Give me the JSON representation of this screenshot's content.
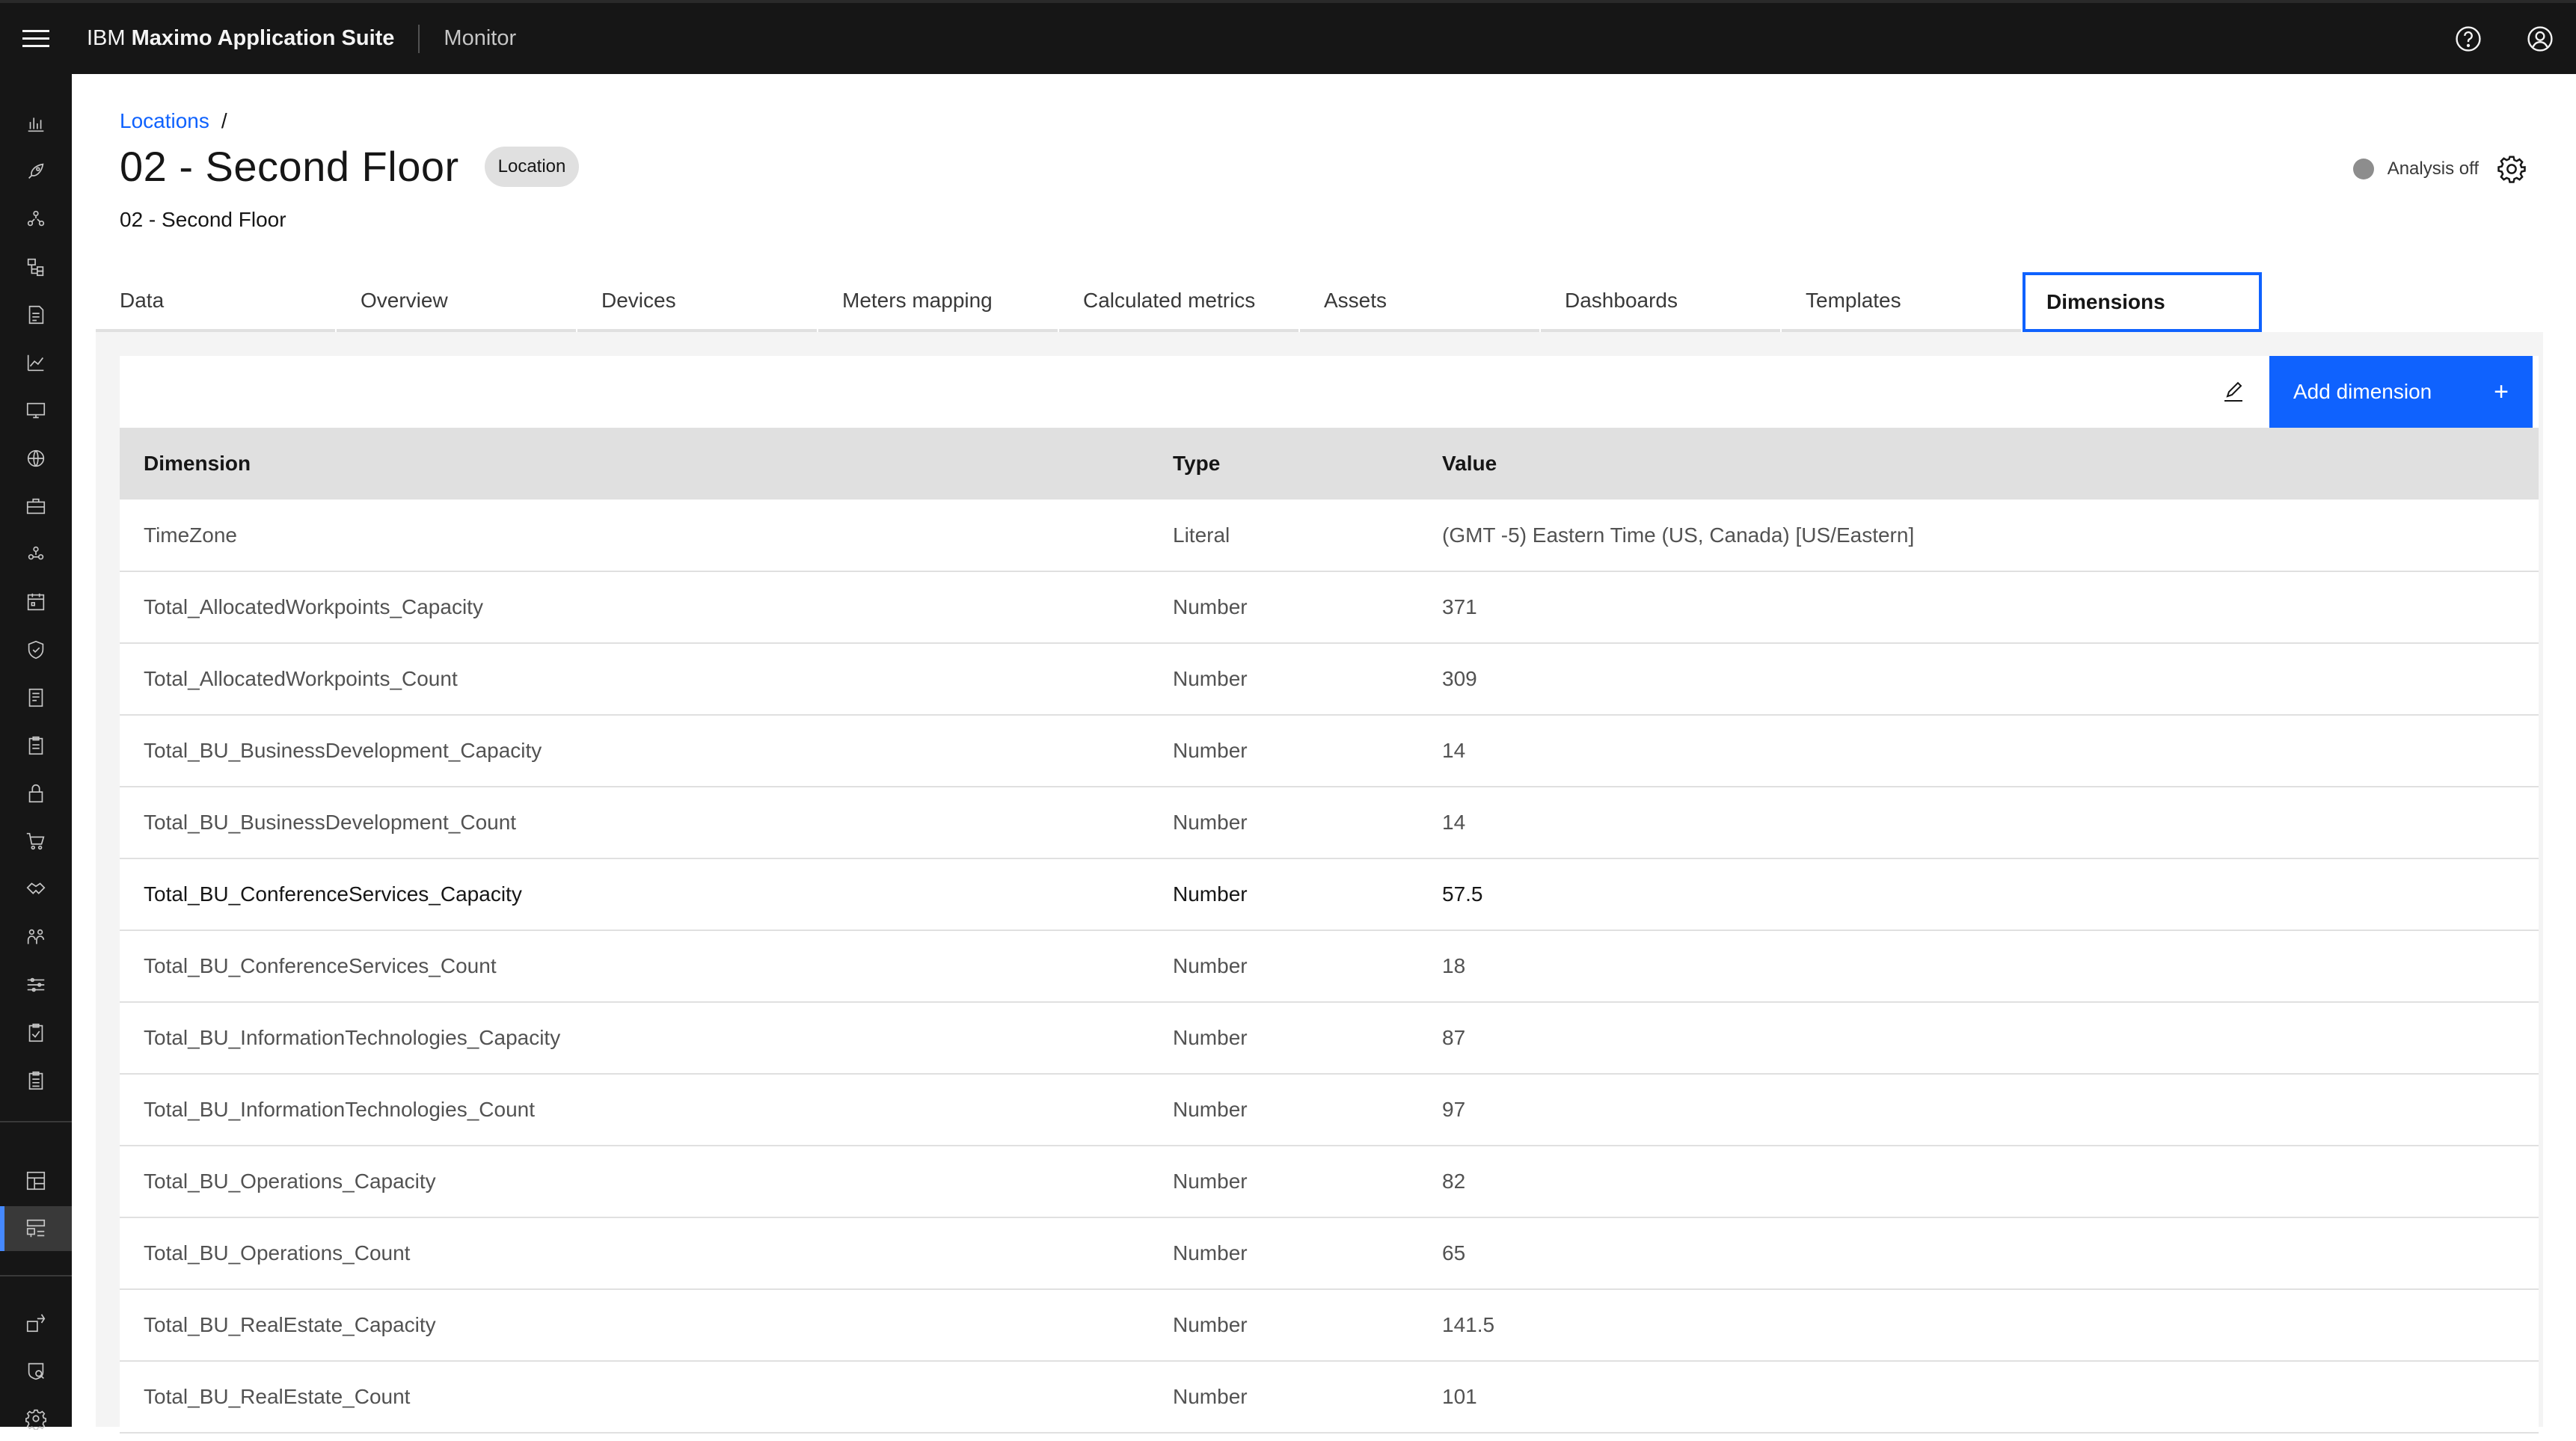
{
  "header": {
    "brand_prefix": "IBM",
    "brand_name": "Maximo Application Suite",
    "product": "Monitor"
  },
  "sidenav": {
    "icons": [
      "chart-bar-icon",
      "rocket-icon",
      "network-icon",
      "tree-view-icon",
      "report-icon",
      "chart-line-icon",
      "monitor-icon",
      "globe-icon",
      "toolbox-icon",
      "asset-icon",
      "calendar-icon",
      "shield-icon",
      "document-icon",
      "clipboard-icon",
      "lock-icon",
      "cart-icon",
      "handshake-icon",
      "users-icon",
      "settings-adjust-icon",
      "task-icon",
      "list-icon",
      "dashboard-icon",
      "hierarchy-icon",
      "switch-icon",
      "security-icon",
      "gear-icon"
    ]
  },
  "breadcrumb": {
    "link": "Locations",
    "separator": "/"
  },
  "page": {
    "title": "02 - Second Floor",
    "tag": "Location",
    "subtitle": "02 - Second Floor",
    "analysis_status": "Analysis off"
  },
  "tabs": [
    {
      "label": "Data"
    },
    {
      "label": "Overview"
    },
    {
      "label": "Devices"
    },
    {
      "label": "Meters mapping"
    },
    {
      "label": "Calculated metrics"
    },
    {
      "label": "Assets"
    },
    {
      "label": "Dashboards"
    },
    {
      "label": "Templates"
    },
    {
      "label": "Dimensions",
      "selected": true
    }
  ],
  "toolbar": {
    "add_label": "Add dimension",
    "add_symbol": "+"
  },
  "table": {
    "headers": {
      "dimension": "Dimension",
      "type": "Type",
      "value": "Value"
    },
    "rows": [
      {
        "dimension": "TimeZone",
        "type": "Literal",
        "value": "(GMT -5) Eastern Time (US, Canada) [US/Eastern]"
      },
      {
        "dimension": "Total_AllocatedWorkpoints_Capacity",
        "type": "Number",
        "value": "371"
      },
      {
        "dimension": "Total_AllocatedWorkpoints_Count",
        "type": "Number",
        "value": "309"
      },
      {
        "dimension": "Total_BU_BusinessDevelopment_Capacity",
        "type": "Number",
        "value": "14"
      },
      {
        "dimension": "Total_BU_BusinessDevelopment_Count",
        "type": "Number",
        "value": "14"
      },
      {
        "dimension": "Total_BU_ConferenceServices_Capacity",
        "type": "Number",
        "value": "57.5"
      },
      {
        "dimension": "Total_BU_ConferenceServices_Count",
        "type": "Number",
        "value": "18"
      },
      {
        "dimension": "Total_BU_InformationTechnologies_Capacity",
        "type": "Number",
        "value": "87"
      },
      {
        "dimension": "Total_BU_InformationTechnologies_Count",
        "type": "Number",
        "value": "97"
      },
      {
        "dimension": "Total_BU_Operations_Capacity",
        "type": "Number",
        "value": "82"
      },
      {
        "dimension": "Total_BU_Operations_Count",
        "type": "Number",
        "value": "65"
      },
      {
        "dimension": "Total_BU_RealEstate_Capacity",
        "type": "Number",
        "value": "141.5"
      },
      {
        "dimension": "Total_BU_RealEstate_Count",
        "type": "Number",
        "value": "101"
      }
    ]
  },
  "colors": {
    "header_bg": "#161616",
    "accent": "#0f62fe",
    "table_header_bg": "#e0e0e0",
    "status_off": "#8d8d8d"
  }
}
